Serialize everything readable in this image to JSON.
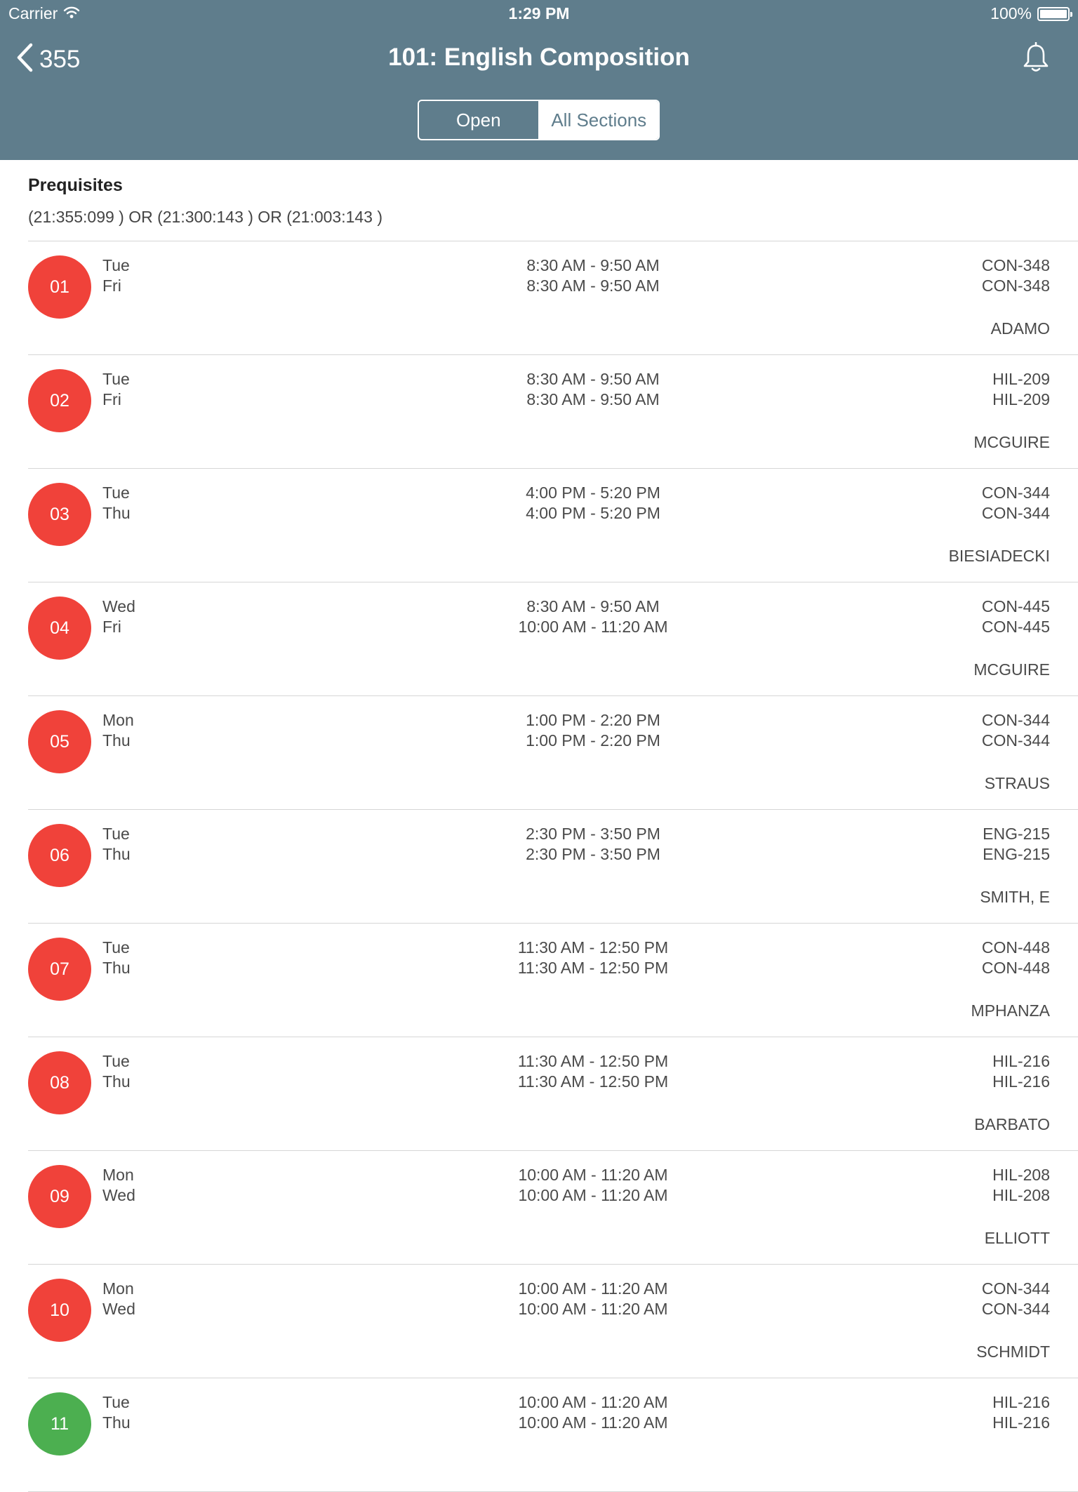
{
  "status": {
    "carrier": "Carrier",
    "time": "1:29 PM",
    "battery": "100%"
  },
  "nav": {
    "back_label": "355",
    "title": "101: English Composition"
  },
  "segments": {
    "open": "Open",
    "all": "All Sections"
  },
  "prereq": {
    "title": "Prequisites",
    "text": "(21:355:099 ) OR (21:300:143 ) OR (21:003:143 )"
  },
  "colors": {
    "header": "#5f7d8c",
    "closed": "#f0423a",
    "open": "#4caf50"
  },
  "sections": [
    {
      "number": "01",
      "status": "closed",
      "days": [
        "Tue",
        "Fri"
      ],
      "times": [
        "8:30 AM - 9:50 AM",
        "8:30 AM - 9:50 AM"
      ],
      "rooms": [
        "CON-348",
        "CON-348"
      ],
      "instructor": "ADAMO"
    },
    {
      "number": "02",
      "status": "closed",
      "days": [
        "Tue",
        "Fri"
      ],
      "times": [
        "8:30 AM - 9:50 AM",
        "8:30 AM - 9:50 AM"
      ],
      "rooms": [
        "HIL-209",
        "HIL-209"
      ],
      "instructor": "MCGUIRE"
    },
    {
      "number": "03",
      "status": "closed",
      "days": [
        "Tue",
        "Thu"
      ],
      "times": [
        "4:00 PM - 5:20 PM",
        "4:00 PM - 5:20 PM"
      ],
      "rooms": [
        "CON-344",
        "CON-344"
      ],
      "instructor": "BIESIADECKI"
    },
    {
      "number": "04",
      "status": "closed",
      "days": [
        "Wed",
        "Fri"
      ],
      "times": [
        "8:30 AM - 9:50 AM",
        "10:00 AM - 11:20 AM"
      ],
      "rooms": [
        "CON-445",
        "CON-445"
      ],
      "instructor": "MCGUIRE"
    },
    {
      "number": "05",
      "status": "closed",
      "days": [
        "Mon",
        "Thu"
      ],
      "times": [
        "1:00 PM - 2:20 PM",
        "1:00 PM - 2:20 PM"
      ],
      "rooms": [
        "CON-344",
        "CON-344"
      ],
      "instructor": "STRAUS"
    },
    {
      "number": "06",
      "status": "closed",
      "days": [
        "Tue",
        "Thu"
      ],
      "times": [
        "2:30 PM - 3:50 PM",
        "2:30 PM - 3:50 PM"
      ],
      "rooms": [
        "ENG-215",
        "ENG-215"
      ],
      "instructor": "SMITH, E"
    },
    {
      "number": "07",
      "status": "closed",
      "days": [
        "Tue",
        "Thu"
      ],
      "times": [
        "11:30 AM - 12:50 PM",
        "11:30 AM - 12:50 PM"
      ],
      "rooms": [
        "CON-448",
        "CON-448"
      ],
      "instructor": "MPHANZA"
    },
    {
      "number": "08",
      "status": "closed",
      "days": [
        "Tue",
        "Thu"
      ],
      "times": [
        "11:30 AM - 12:50 PM",
        "11:30 AM - 12:50 PM"
      ],
      "rooms": [
        "HIL-216",
        "HIL-216"
      ],
      "instructor": "BARBATO"
    },
    {
      "number": "09",
      "status": "closed",
      "days": [
        "Mon",
        "Wed"
      ],
      "times": [
        "10:00 AM - 11:20 AM",
        "10:00 AM - 11:20 AM"
      ],
      "rooms": [
        "HIL-208",
        "HIL-208"
      ],
      "instructor": "ELLIOTT"
    },
    {
      "number": "10",
      "status": "closed",
      "days": [
        "Mon",
        "Wed"
      ],
      "times": [
        "10:00 AM - 11:20 AM",
        "10:00 AM - 11:20 AM"
      ],
      "rooms": [
        "CON-344",
        "CON-344"
      ],
      "instructor": "SCHMIDT"
    },
    {
      "number": "11",
      "status": "open",
      "days": [
        "Tue",
        "Thu"
      ],
      "times": [
        "10:00 AM - 11:20 AM",
        "10:00 AM - 11:20 AM"
      ],
      "rooms": [
        "HIL-216",
        "HIL-216"
      ],
      "instructor": ""
    }
  ]
}
